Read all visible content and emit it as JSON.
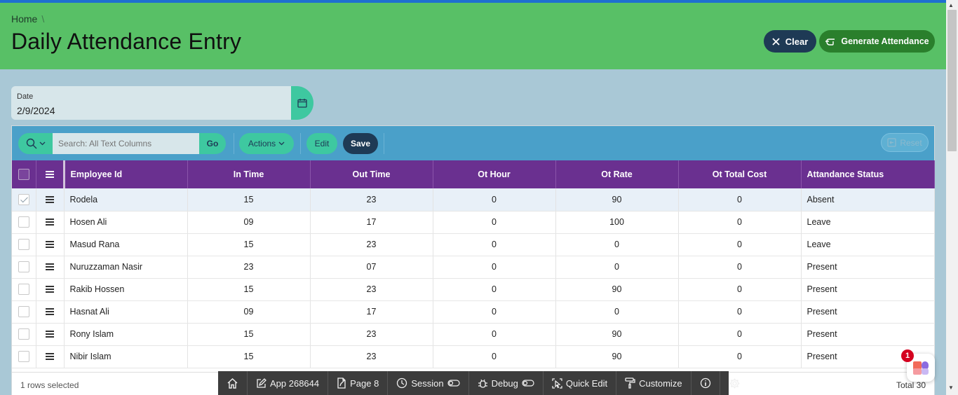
{
  "breadcrumb": {
    "home": "Home",
    "separator": "\\"
  },
  "page": {
    "title": "Daily Attendance Entry"
  },
  "header_buttons": {
    "clear": "Clear",
    "generate": "Generate Attendance"
  },
  "date_field": {
    "label": "Date",
    "value": "2/9/2024"
  },
  "toolbar": {
    "search_placeholder": "Search: All Text Columns",
    "go": "Go",
    "actions": "Actions",
    "edit": "Edit",
    "save": "Save",
    "reset": "Reset"
  },
  "table": {
    "columns": [
      "Employee Id",
      "In Time",
      "Out Time",
      "Ot Hour",
      "Ot Rate",
      "Ot Total Cost",
      "Attandance Status"
    ],
    "rows": [
      {
        "employee": "Rodela",
        "in_time": "15",
        "out_time": "23",
        "ot_hour": "0",
        "ot_rate": "90",
        "ot_total_cost": "0",
        "status": "Absent",
        "selected": true
      },
      {
        "employee": "Hosen Ali",
        "in_time": "09",
        "out_time": "17",
        "ot_hour": "0",
        "ot_rate": "100",
        "ot_total_cost": "0",
        "status": "Leave",
        "selected": false
      },
      {
        "employee": "Masud Rana",
        "in_time": "15",
        "out_time": "23",
        "ot_hour": "0",
        "ot_rate": "0",
        "ot_total_cost": "0",
        "status": "Leave",
        "selected": false
      },
      {
        "employee": "Nuruzzaman Nasir",
        "in_time": "23",
        "out_time": "07",
        "ot_hour": "0",
        "ot_rate": "0",
        "ot_total_cost": "0",
        "status": "Present",
        "selected": false
      },
      {
        "employee": "Rakib Hossen",
        "in_time": "15",
        "out_time": "23",
        "ot_hour": "0",
        "ot_rate": "90",
        "ot_total_cost": "0",
        "status": "Present",
        "selected": false
      },
      {
        "employee": "Hasnat Ali",
        "in_time": "09",
        "out_time": "17",
        "ot_hour": "0",
        "ot_rate": "0",
        "ot_total_cost": "0",
        "status": "Present",
        "selected": false
      },
      {
        "employee": "Rony Islam",
        "in_time": "15",
        "out_time": "23",
        "ot_hour": "0",
        "ot_rate": "90",
        "ot_total_cost": "0",
        "status": "Present",
        "selected": false
      },
      {
        "employee": "Nibir Islam",
        "in_time": "15",
        "out_time": "23",
        "ot_hour": "0",
        "ot_rate": "90",
        "ot_total_cost": "0",
        "status": "Present",
        "selected": false
      }
    ]
  },
  "footer": {
    "selected": "1 rows selected",
    "total": "Total 30"
  },
  "dev_toolbar": {
    "app": "App 268644",
    "page": "Page 8",
    "session": "Session",
    "debug": "Debug",
    "quick_edit": "Quick Edit",
    "customize": "Customize"
  },
  "notification": {
    "count": "1"
  },
  "icons": [
    "close-icon",
    "hand-pointer-icon",
    "calendar-icon",
    "search-icon",
    "chevron-down-icon",
    "reset-icon",
    "home-icon",
    "edit-icon",
    "page-icon",
    "clock-icon",
    "toggle-icon",
    "bug-icon",
    "quick-edit-icon",
    "paint-roller-icon",
    "info-icon",
    "gear-icon"
  ],
  "colors": {
    "header_green": "#58c066",
    "toolbar_blue": "#4aa0c9",
    "table_header_purple": "#6a3090",
    "accent_teal": "#3ec8a0",
    "navy": "#1e3a55"
  }
}
